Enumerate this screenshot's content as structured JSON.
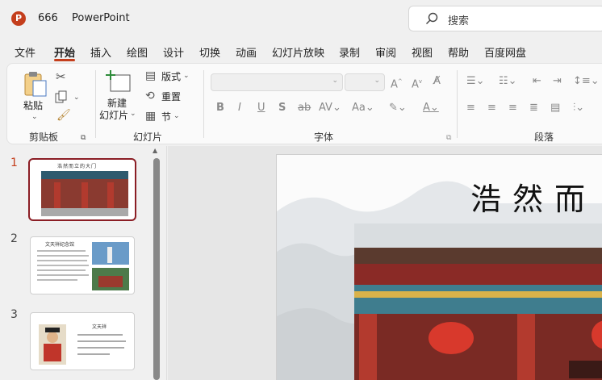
{
  "titlebar": {
    "app_logo": "P",
    "doc_name": "666",
    "app_name": "PowerPoint",
    "search_placeholder": "搜索"
  },
  "tabs": [
    {
      "label": "文件"
    },
    {
      "label": "开始",
      "active": true
    },
    {
      "label": "插入"
    },
    {
      "label": "绘图"
    },
    {
      "label": "设计"
    },
    {
      "label": "切换"
    },
    {
      "label": "动画"
    },
    {
      "label": "幻灯片放映"
    },
    {
      "label": "录制"
    },
    {
      "label": "审阅"
    },
    {
      "label": "视图"
    },
    {
      "label": "帮助"
    },
    {
      "label": "百度网盘"
    }
  ],
  "ribbon": {
    "clipboard": {
      "paste": "粘贴",
      "group": "剪贴板"
    },
    "slides": {
      "new_slide_1": "新建",
      "new_slide_2": "幻灯片",
      "layout": "版式",
      "reset": "重置",
      "section": "节",
      "group": "幻灯片"
    },
    "font": {
      "group": "字体"
    },
    "paragraph": {
      "group": "段落"
    }
  },
  "thumbnails": [
    {
      "number": "1",
      "title": "浩然而立的大门",
      "selected": true
    },
    {
      "number": "2",
      "title": "文天祥纪念馆"
    },
    {
      "number": "3",
      "title": "文天祥"
    }
  ],
  "slide": {
    "title": "浩然而"
  },
  "colors": {
    "accent": "#c43e1c",
    "selection": "#8b1e25"
  }
}
